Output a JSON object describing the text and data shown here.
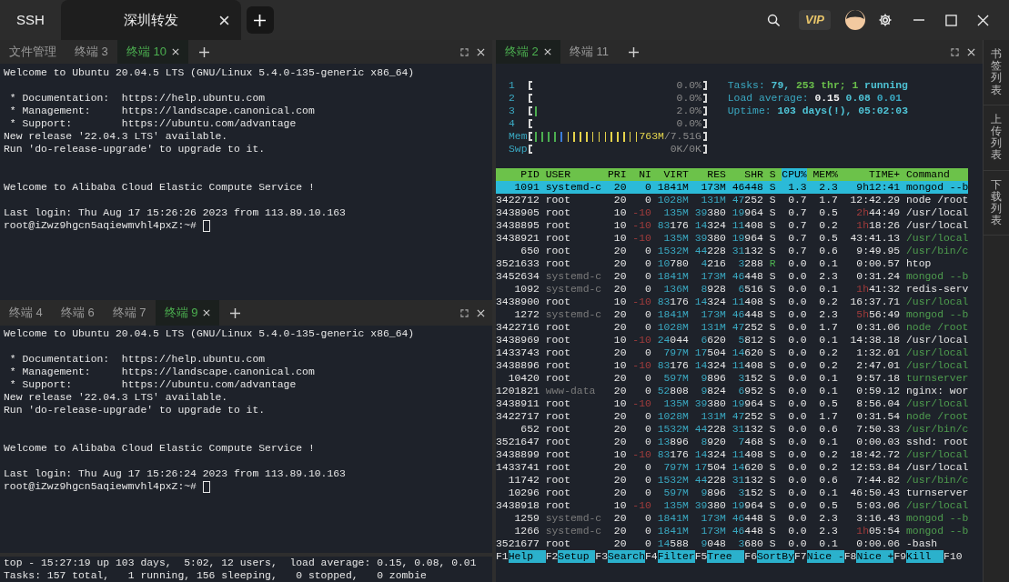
{
  "title_bar": {
    "tabs": [
      {
        "label": "SSH",
        "selected": false
      },
      {
        "label": "深圳转发",
        "selected": true
      }
    ],
    "vip_badge": "VIP"
  },
  "left_panes": [
    {
      "tabs": [
        {
          "label": "文件管理",
          "selected": false
        },
        {
          "label": "终端 3",
          "selected": false
        },
        {
          "label": "终端 10",
          "selected": true
        }
      ],
      "cursor": true,
      "lines": [
        {
          "kind": "text",
          "text": "Welcome to Ubuntu 20.04.5 LTS (GNU/Linux 5.4.0-135-generic x86_64)"
        },
        {
          "kind": "blank"
        },
        {
          "kind": "text",
          "text": " * Documentation:  https://help.ubuntu.com"
        },
        {
          "kind": "text",
          "text": " * Management:     https://landscape.canonical.com"
        },
        {
          "kind": "text",
          "text": " * Support:        https://ubuntu.com/advantage"
        },
        {
          "kind": "text",
          "text": "New release '22.04.3 LTS' available."
        },
        {
          "kind": "text",
          "text": "Run 'do-release-upgrade' to upgrade to it."
        },
        {
          "kind": "blank"
        },
        {
          "kind": "blank"
        },
        {
          "kind": "text",
          "text": "Welcome to Alibaba Cloud Elastic Compute Service !"
        },
        {
          "kind": "blank"
        },
        {
          "kind": "text",
          "text": "Last login: Thu Aug 17 15:26:26 2023 from 113.89.10.163"
        },
        {
          "kind": "text",
          "text": "root@iZwz9hgcn5aqiewmvhl4pxZ:~#"
        }
      ]
    },
    {
      "tabs": [
        {
          "label": "终端 4",
          "selected": false
        },
        {
          "label": "终端 6",
          "selected": false
        },
        {
          "label": "终端 7",
          "selected": false
        },
        {
          "label": "终端 9",
          "selected": true
        }
      ],
      "cursor": true,
      "lines": [
        {
          "kind": "text",
          "text": "Welcome to Ubuntu 20.04.5 LTS (GNU/Linux 5.4.0-135-generic x86_64)"
        },
        {
          "kind": "blank"
        },
        {
          "kind": "text",
          "text": " * Documentation:  https://help.ubuntu.com"
        },
        {
          "kind": "text",
          "text": " * Management:     https://landscape.canonical.com"
        },
        {
          "kind": "text",
          "text": " * Support:        https://ubuntu.com/advantage"
        },
        {
          "kind": "text",
          "text": "New release '22.04.3 LTS' available."
        },
        {
          "kind": "text",
          "text": "Run 'do-release-upgrade' to upgrade to it."
        },
        {
          "kind": "blank"
        },
        {
          "kind": "blank"
        },
        {
          "kind": "text",
          "text": "Welcome to Alibaba Cloud Elastic Compute Service !"
        },
        {
          "kind": "blank"
        },
        {
          "kind": "text",
          "text": "Last login: Thu Aug 17 15:26:24 2023 from 113.89.10.163"
        },
        {
          "kind": "text",
          "text": "root@iZwz9hgcn5aqiewmvhl4pxZ:~#"
        }
      ]
    }
  ],
  "bottom_pane": {
    "lines": [
      "top - 15:27:19 up 103 days,  5:02, 12 users,  load average: 0.15, 0.08, 0.01",
      "Tasks: 157 total,   1 running, 156 sleeping,   0 stopped,   0 zombie"
    ]
  },
  "htop_pane": {
    "tabs": [
      {
        "label": "终端 2",
        "selected": true
      },
      {
        "label": "终端 11",
        "selected": false
      }
    ],
    "meters": [
      {
        "label": "1",
        "reading": [
          {
            "text": "0.0%",
            "color": "#8a8a8a"
          }
        ]
      },
      {
        "label": "2",
        "reading": [
          {
            "text": "0.0%",
            "color": "#8a8a8a"
          }
        ]
      },
      {
        "label": "3",
        "level": 0.03,
        "segments": [
          {
            "color": "#4caf50"
          }
        ],
        "reading": [
          {
            "text": "2.0%",
            "color": "#8a8a8a"
          }
        ]
      },
      {
        "label": "4",
        "reading": [
          {
            "text": "0.0%",
            "color": "#8a8a8a"
          }
        ]
      },
      {
        "label": "Mem",
        "segments": [
          {
            "color": "#4caf50"
          },
          {
            "color": "#3b7dd8"
          },
          {
            "color": "#e5d34a"
          }
        ],
        "reading": [
          {
            "text": "763M",
            "color": "#e8d84e"
          },
          {
            "text": "/7.51G",
            "color": "#8a8a8a"
          }
        ]
      },
      {
        "label": "Swp",
        "reading": [
          {
            "text": "0K/0K",
            "color": "#8a8a8a"
          }
        ]
      }
    ],
    "summary": [
      {
        "label": "Tasks:",
        "parts": [
          {
            "text": "79,",
            "color": "#4fc4d6"
          },
          {
            "text": "253",
            "color": "#6abf4b"
          },
          {
            "text": "thr;",
            "color": "#6abf4b"
          },
          {
            "text": "1",
            "color": "#6abf4b"
          },
          {
            "text": "running",
            "color": "#4fc4d6"
          }
        ]
      },
      {
        "label": "Load average:",
        "parts": [
          {
            "text": "0.15",
            "color": "#f0f0f0"
          },
          {
            "text": "0.08",
            "color": "#4fc4d6"
          },
          {
            "text": "0.01",
            "color": "#3aa8c1"
          }
        ]
      },
      {
        "label": "Uptime:",
        "parts": [
          {
            "text": "103 days(!),",
            "color": "#4fc4d6"
          },
          {
            "text": "05:02:03",
            "color": "#4fc4d6"
          }
        ]
      }
    ],
    "columns": [
      {
        "label": "PID",
        "sorted": false
      },
      {
        "label": "USER",
        "sorted": false
      },
      {
        "label": "PRI",
        "sorted": false
      },
      {
        "label": "NI",
        "sorted": false
      },
      {
        "label": "VIRT",
        "sorted": false
      },
      {
        "label": "RES",
        "sorted": false
      },
      {
        "label": "SHR",
        "sorted": false
      },
      {
        "label": "S",
        "sorted": false
      },
      {
        "label": "CPU%",
        "sorted": true
      },
      {
        "label": "MEM%",
        "sorted": false
      },
      {
        "label": "TIME+",
        "sorted": false
      },
      {
        "label": "Command",
        "sorted": false
      }
    ],
    "processes": [
      {
        "pid": "1091",
        "user": "systemd-c",
        "pri": "20",
        "ni": "0",
        "virt": "1841M",
        "res": "173M",
        "shr": "46448",
        "state": "S",
        "cpu": "1.3",
        "mem": "2.3",
        "time": "9h12:41",
        "command": "mongod --b",
        "selected": true,
        "thread": false,
        "dim_user": false,
        "running": false
      },
      {
        "pid": "3422712",
        "user": "root",
        "pri": "20",
        "ni": "0",
        "virt": "1028M",
        "res": "131M",
        "shr": "47252",
        "state": "S",
        "cpu": "0.7",
        "mem": "1.7",
        "time": "12:42.29",
        "command": "node /root",
        "selected": false,
        "thread": false,
        "dim_user": false,
        "running": false
      },
      {
        "pid": "3438905",
        "user": "root",
        "pri": "10",
        "ni": "-10",
        "virt": "135M",
        "res": "39380",
        "shr": "19964",
        "state": "S",
        "cpu": "0.7",
        "mem": "0.5",
        "time": "2h44:49",
        "command": "/usr/local",
        "selected": false,
        "thread": false,
        "dim_user": false,
        "running": false
      },
      {
        "pid": "3438895",
        "user": "root",
        "pri": "10",
        "ni": "-10",
        "virt": "83176",
        "res": "14324",
        "shr": "11408",
        "state": "S",
        "cpu": "0.7",
        "mem": "0.2",
        "time": "1h18:26",
        "command": "/usr/local",
        "selected": false,
        "thread": false,
        "dim_user": false,
        "running": false
      },
      {
        "pid": "3438921",
        "user": "root",
        "pri": "10",
        "ni": "-10",
        "virt": "135M",
        "res": "39380",
        "shr": "19964",
        "state": "S",
        "cpu": "0.7",
        "mem": "0.5",
        "time": "43:41.13",
        "command": "/usr/local",
        "selected": false,
        "thread": true,
        "dim_user": false,
        "running": false
      },
      {
        "pid": "650",
        "user": "root",
        "pri": "20",
        "ni": "0",
        "virt": "1532M",
        "res": "44228",
        "shr": "31132",
        "state": "S",
        "cpu": "0.7",
        "mem": "0.6",
        "time": "9:49.95",
        "command": "/usr/bin/c",
        "selected": false,
        "thread": true,
        "dim_user": false,
        "running": false
      },
      {
        "pid": "3521633",
        "user": "root",
        "pri": "20",
        "ni": "0",
        "virt": "10780",
        "res": "4216",
        "shr": "3288",
        "state": "R",
        "cpu": "0.0",
        "mem": "0.1",
        "time": "0:00.57",
        "command": "htop",
        "selected": false,
        "thread": false,
        "dim_user": false,
        "running": true
      },
      {
        "pid": "3452634",
        "user": "systemd-c",
        "pri": "20",
        "ni": "0",
        "virt": "1841M",
        "res": "173M",
        "shr": "46448",
        "state": "S",
        "cpu": "0.0",
        "mem": "2.3",
        "time": "0:31.24",
        "command": "mongod --b",
        "selected": false,
        "thread": true,
        "dim_user": true,
        "running": false
      },
      {
        "pid": "1092",
        "user": "systemd-c",
        "pri": "20",
        "ni": "0",
        "virt": "136M",
        "res": "8928",
        "shr": "6516",
        "state": "S",
        "cpu": "0.0",
        "mem": "0.1",
        "time": "1h41:32",
        "command": "redis-serv",
        "selected": false,
        "thread": false,
        "dim_user": true,
        "running": false
      },
      {
        "pid": "3438900",
        "user": "root",
        "pri": "10",
        "ni": "-10",
        "virt": "83176",
        "res": "14324",
        "shr": "11408",
        "state": "S",
        "cpu": "0.0",
        "mem": "0.2",
        "time": "16:37.71",
        "command": "/usr/local",
        "selected": false,
        "thread": true,
        "dim_user": false,
        "running": false
      },
      {
        "pid": "1272",
        "user": "systemd-c",
        "pri": "20",
        "ni": "0",
        "virt": "1841M",
        "res": "173M",
        "shr": "46448",
        "state": "S",
        "cpu": "0.0",
        "mem": "2.3",
        "time": "5h56:49",
        "command": "mongod --b",
        "selected": false,
        "thread": true,
        "dim_user": true,
        "running": false
      },
      {
        "pid": "3422716",
        "user": "root",
        "pri": "20",
        "ni": "0",
        "virt": "1028M",
        "res": "131M",
        "shr": "47252",
        "state": "S",
        "cpu": "0.0",
        "mem": "1.7",
        "time": "0:31.06",
        "command": "node /root",
        "selected": false,
        "thread": true,
        "dim_user": false,
        "running": false
      },
      {
        "pid": "3438969",
        "user": "root",
        "pri": "10",
        "ni": "-10",
        "virt": "24044",
        "res": "6620",
        "shr": "5812",
        "state": "S",
        "cpu": "0.0",
        "mem": "0.1",
        "time": "14:38.18",
        "command": "/usr/local",
        "selected": false,
        "thread": false,
        "dim_user": false,
        "running": false
      },
      {
        "pid": "1433743",
        "user": "root",
        "pri": "20",
        "ni": "0",
        "virt": "797M",
        "res": "17504",
        "shr": "14620",
        "state": "S",
        "cpu": "0.0",
        "mem": "0.2",
        "time": "1:32.01",
        "command": "/usr/local",
        "selected": false,
        "thread": true,
        "dim_user": false,
        "running": false
      },
      {
        "pid": "3438896",
        "user": "root",
        "pri": "10",
        "ni": "-10",
        "virt": "83176",
        "res": "14324",
        "shr": "11408",
        "state": "S",
        "cpu": "0.0",
        "mem": "0.2",
        "time": "2:47.01",
        "command": "/usr/local",
        "selected": false,
        "thread": true,
        "dim_user": false,
        "running": false
      },
      {
        "pid": "10420",
        "user": "root",
        "pri": "20",
        "ni": "0",
        "virt": "597M",
        "res": "9896",
        "shr": "3152",
        "state": "S",
        "cpu": "0.0",
        "mem": "0.1",
        "time": "9:57.18",
        "command": "turnserver",
        "selected": false,
        "thread": true,
        "dim_user": false,
        "running": false
      },
      {
        "pid": "1201821",
        "user": "www-data",
        "pri": "20",
        "ni": "0",
        "virt": "52808",
        "res": "9824",
        "shr": "6952",
        "state": "S",
        "cpu": "0.0",
        "mem": "0.1",
        "time": "0:59.12",
        "command": "nginx: wor",
        "selected": false,
        "thread": false,
        "dim_user": true,
        "running": false
      },
      {
        "pid": "3438911",
        "user": "root",
        "pri": "10",
        "ni": "-10",
        "virt": "135M",
        "res": "39380",
        "shr": "19964",
        "state": "S",
        "cpu": "0.0",
        "mem": "0.5",
        "time": "8:56.04",
        "command": "/usr/local",
        "selected": false,
        "thread": true,
        "dim_user": false,
        "running": false
      },
      {
        "pid": "3422717",
        "user": "root",
        "pri": "20",
        "ni": "0",
        "virt": "1028M",
        "res": "131M",
        "shr": "47252",
        "state": "S",
        "cpu": "0.0",
        "mem": "1.7",
        "time": "0:31.54",
        "command": "node /root",
        "selected": false,
        "thread": true,
        "dim_user": false,
        "running": false
      },
      {
        "pid": "652",
        "user": "root",
        "pri": "20",
        "ni": "0",
        "virt": "1532M",
        "res": "44228",
        "shr": "31132",
        "state": "S",
        "cpu": "0.0",
        "mem": "0.6",
        "time": "7:50.33",
        "command": "/usr/bin/c",
        "selected": false,
        "thread": true,
        "dim_user": false,
        "running": false
      },
      {
        "pid": "3521647",
        "user": "root",
        "pri": "20",
        "ni": "0",
        "virt": "13896",
        "res": "8920",
        "shr": "7468",
        "state": "S",
        "cpu": "0.0",
        "mem": "0.1",
        "time": "0:00.03",
        "command": "sshd: root",
        "selected": false,
        "thread": false,
        "dim_user": false,
        "running": false
      },
      {
        "pid": "3438899",
        "user": "root",
        "pri": "10",
        "ni": "-10",
        "virt": "83176",
        "res": "14324",
        "shr": "11408",
        "state": "S",
        "cpu": "0.0",
        "mem": "0.2",
        "time": "18:42.72",
        "command": "/usr/local",
        "selected": false,
        "thread": true,
        "dim_user": false,
        "running": false
      },
      {
        "pid": "1433741",
        "user": "root",
        "pri": "20",
        "ni": "0",
        "virt": "797M",
        "res": "17504",
        "shr": "14620",
        "state": "S",
        "cpu": "0.0",
        "mem": "0.2",
        "time": "12:53.84",
        "command": "/usr/local",
        "selected": false,
        "thread": false,
        "dim_user": false,
        "running": false
      },
      {
        "pid": "11742",
        "user": "root",
        "pri": "20",
        "ni": "0",
        "virt": "1532M",
        "res": "44228",
        "shr": "31132",
        "state": "S",
        "cpu": "0.0",
        "mem": "0.6",
        "time": "7:44.82",
        "command": "/usr/bin/c",
        "selected": false,
        "thread": true,
        "dim_user": false,
        "running": false
      },
      {
        "pid": "10296",
        "user": "root",
        "pri": "20",
        "ni": "0",
        "virt": "597M",
        "res": "9896",
        "shr": "3152",
        "state": "S",
        "cpu": "0.0",
        "mem": "0.1",
        "time": "46:50.43",
        "command": "turnserver",
        "selected": false,
        "thread": false,
        "dim_user": false,
        "running": false
      },
      {
        "pid": "3438918",
        "user": "root",
        "pri": "10",
        "ni": "-10",
        "virt": "135M",
        "res": "39380",
        "shr": "19964",
        "state": "S",
        "cpu": "0.0",
        "mem": "0.5",
        "time": "5:03.06",
        "command": "/usr/local",
        "selected": false,
        "thread": true,
        "dim_user": false,
        "running": false
      },
      {
        "pid": "1259",
        "user": "systemd-c",
        "pri": "20",
        "ni": "0",
        "virt": "1841M",
        "res": "173M",
        "shr": "46448",
        "state": "S",
        "cpu": "0.0",
        "mem": "2.3",
        "time": "3:16.43",
        "command": "mongod --b",
        "selected": false,
        "thread": true,
        "dim_user": true,
        "running": false
      },
      {
        "pid": "1266",
        "user": "systemd-c",
        "pri": "20",
        "ni": "0",
        "virt": "1841M",
        "res": "173M",
        "shr": "46448",
        "state": "S",
        "cpu": "0.0",
        "mem": "2.3",
        "time": "1h05:54",
        "command": "mongod --b",
        "selected": false,
        "thread": true,
        "dim_user": true,
        "running": false
      },
      {
        "pid": "3521677",
        "user": "root",
        "pri": "20",
        "ni": "0",
        "virt": "14588",
        "res": "9048",
        "shr": "3680",
        "state": "S",
        "cpu": "0.0",
        "mem": "0.1",
        "time": "0:00.06",
        "command": "-bash",
        "selected": false,
        "thread": false,
        "dim_user": false,
        "running": false
      }
    ],
    "function_keys": [
      {
        "key": "F1",
        "label": "Help"
      },
      {
        "key": "F2",
        "label": "Setup"
      },
      {
        "key": "F3",
        "label": "Search"
      },
      {
        "key": "F4",
        "label": "Filter"
      },
      {
        "key": "F5",
        "label": "Tree"
      },
      {
        "key": "F6",
        "label": "SortBy"
      },
      {
        "key": "F7",
        "label": "Nice -"
      },
      {
        "key": "F8",
        "label": "Nice +"
      },
      {
        "key": "F9",
        "label": "Kill"
      },
      {
        "key": "F10"
      }
    ]
  },
  "side_panel": {
    "items": [
      "书签列表",
      "上传列表",
      "下载列表"
    ]
  }
}
